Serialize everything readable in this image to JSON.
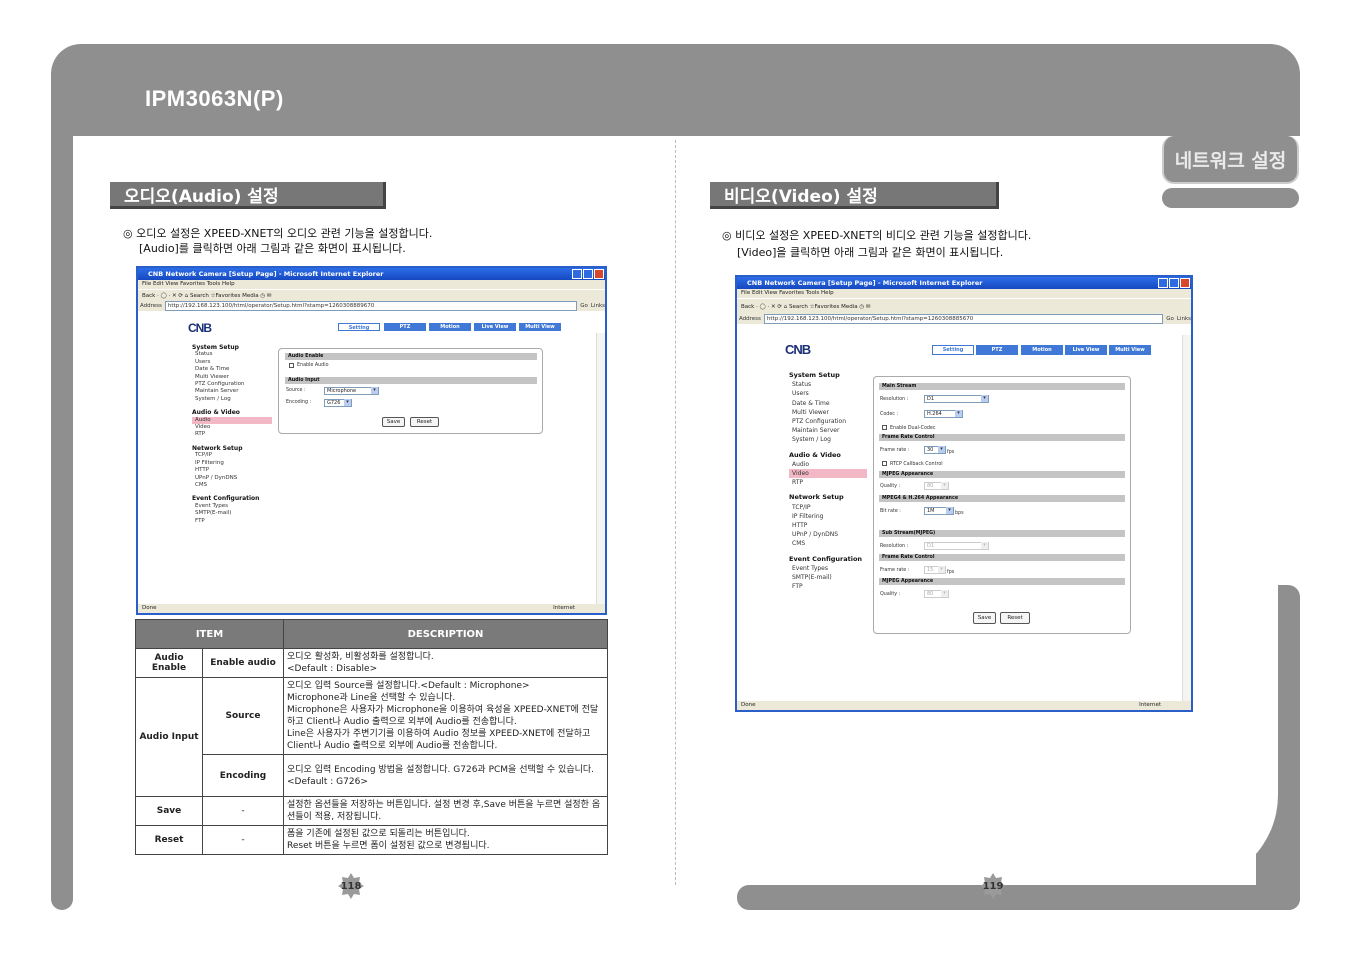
{
  "header": {
    "title": "IPM3063N(P)",
    "tab": "네트워크 설정"
  },
  "left": {
    "section_title": "오디오(Audio) 설정",
    "intro_line1": "◎ 오디오 설정은 XPEED-XNET의 오디오 관련 기능을 설정합니다.",
    "intro_line2": "[Audio]를 클릭하면 아래 그림과 같은 화면이 표시됩니다.",
    "page_number": "118"
  },
  "right": {
    "section_title": "비디오(Video) 설정",
    "intro_line1": "◎ 비디오 설정은 XPEED-XNET의 비디오 관련 기능을 설정합니다.",
    "intro_line2": "[Video]을 클릭하면 아래 그림과 같은 화면이 표시됩니다.",
    "page_number": "119"
  },
  "browser": {
    "title": "CNB Network Camera [Setup Page] - Microsoft Internet Explorer",
    "menu": "File  Edit  View  Favorites  Tools  Help",
    "toolbar": "Back  ·  ◯  ·  ✕  ⟳  ⌂   Search   ☆Favorites   Media   ◷   ✉",
    "address_label": "Address",
    "url_audio": "http://192.168.123.100/html/operator/Setup.html?stamp=1260308889670",
    "url_video": "http://192.168.123.100/html/operator/Setup.html?stamp=1260308885670",
    "go": "Go",
    "links": "Links",
    "status_left": "Done",
    "status_right": "Internet",
    "logo": "CNB",
    "nav": [
      "Setting",
      "PTZ",
      "Motion",
      "Live View",
      "Multi View"
    ]
  },
  "setup_menu": {
    "system_setup": "System Setup",
    "system_items": [
      "Status",
      "Users",
      "Date & Time",
      "Multi Viewer",
      "PTZ Configuration",
      "Maintain Server",
      "System / Log"
    ],
    "audio_video": "Audio & Video",
    "av_items": [
      "Audio",
      "Video",
      "RTP"
    ],
    "network_setup": "Network Setup",
    "network_items": [
      "TCP/IP",
      "IP Filtering",
      "HTTP",
      "UPnP / DynDNS",
      "CMS"
    ],
    "event_configuration": "Event Configuration",
    "event_items": [
      "Event Types",
      "SMTP(E-mail)",
      "FTP"
    ]
  },
  "audio_panel": {
    "enable_header": "Audio Enable",
    "enable_label": "Enable Audio",
    "input_header": "Audio Input",
    "source_label": "Source :",
    "source_value": "Microphone",
    "encoding_label": "Encoding :",
    "encoding_value": "G726",
    "save": "Save",
    "reset": "Reset"
  },
  "video_panel": {
    "main_stream": "Main Stream",
    "resolution_label": "Resolution :",
    "resolution_value": "D1",
    "codec_label": "Codec :",
    "codec_value": "H.264",
    "dual_codec": "Enable Dual-Codec",
    "frame_rate_control": "Frame Rate Control",
    "frame_rate_label": "Frame rate :",
    "frame_rate_value": "30",
    "fps": "fps",
    "rtcp": "RTCP Callback Control",
    "mjpeg_appearance": "MJPEG Appearance",
    "quality_label": "Quality :",
    "quality_value": "80",
    "mpeg4_appearance": "MPEG4 & H.264 Appearance",
    "bitrate_label": "Bit rate :",
    "bitrate_value": "1M",
    "bps": "bps",
    "sub_stream": "Sub Stream(MJPEG)",
    "sub_resolution_value": "D1",
    "sub_frame_rate_value": "15",
    "sub_quality_value": "80",
    "save": "Save",
    "reset": "Reset"
  },
  "table": {
    "headers": [
      "ITEM",
      "DESCRIPTION"
    ],
    "rows": {
      "audio_enable": "Audio Enable",
      "enable_audio": "Enable audio",
      "enable_desc": "오디오 활성화, 비활성화를 설정합니다.\n<Default : Disable>",
      "audio_input": "Audio Input",
      "source": "Source",
      "source_desc": "오디오 입력 Source를 설정합니다.<Default : Microphone>\nMicrophone과 Line을 선택할 수 있습니다.\nMicrophone은 사용자가 Microphone을 이용하여 육성을 XPEED-XNET에 전달하고 Client나 Audio 출력으로 외부에 Audio를 전송합니다.\nLine은 사용자가 주변기기를 이용하여 Audio 정보를 XPEED-XNET에 전달하고 Client나 Audio 출력으로 외부에 Audio를 전송합니다.",
      "encoding": "Encoding",
      "encoding_desc": "오디오 입력 Encoding 방법을 설정합니다. G726과 PCM을 선택할 수 있습니다.\n<Default : G726>",
      "save": "Save",
      "dash": "-",
      "save_desc": "설정한 옵션들을 저장하는 버튼입니다. 설정 변경 후,Save 버튼을 누르면 설정한 옵션들이 적용, 저장됩니다.",
      "reset": "Reset",
      "reset_desc": "폼을 기존에 설정된 값으로 되돌리는 버튼입니다.\nReset 버튼을 누르면 폼이 설정된 값으로 변경됩니다."
    }
  },
  "colors": {
    "frame": "#8f8f8f",
    "section_bg": "#777777",
    "browser_blue": "#2a5fc9",
    "selected_menu": "#f3b8c5"
  }
}
